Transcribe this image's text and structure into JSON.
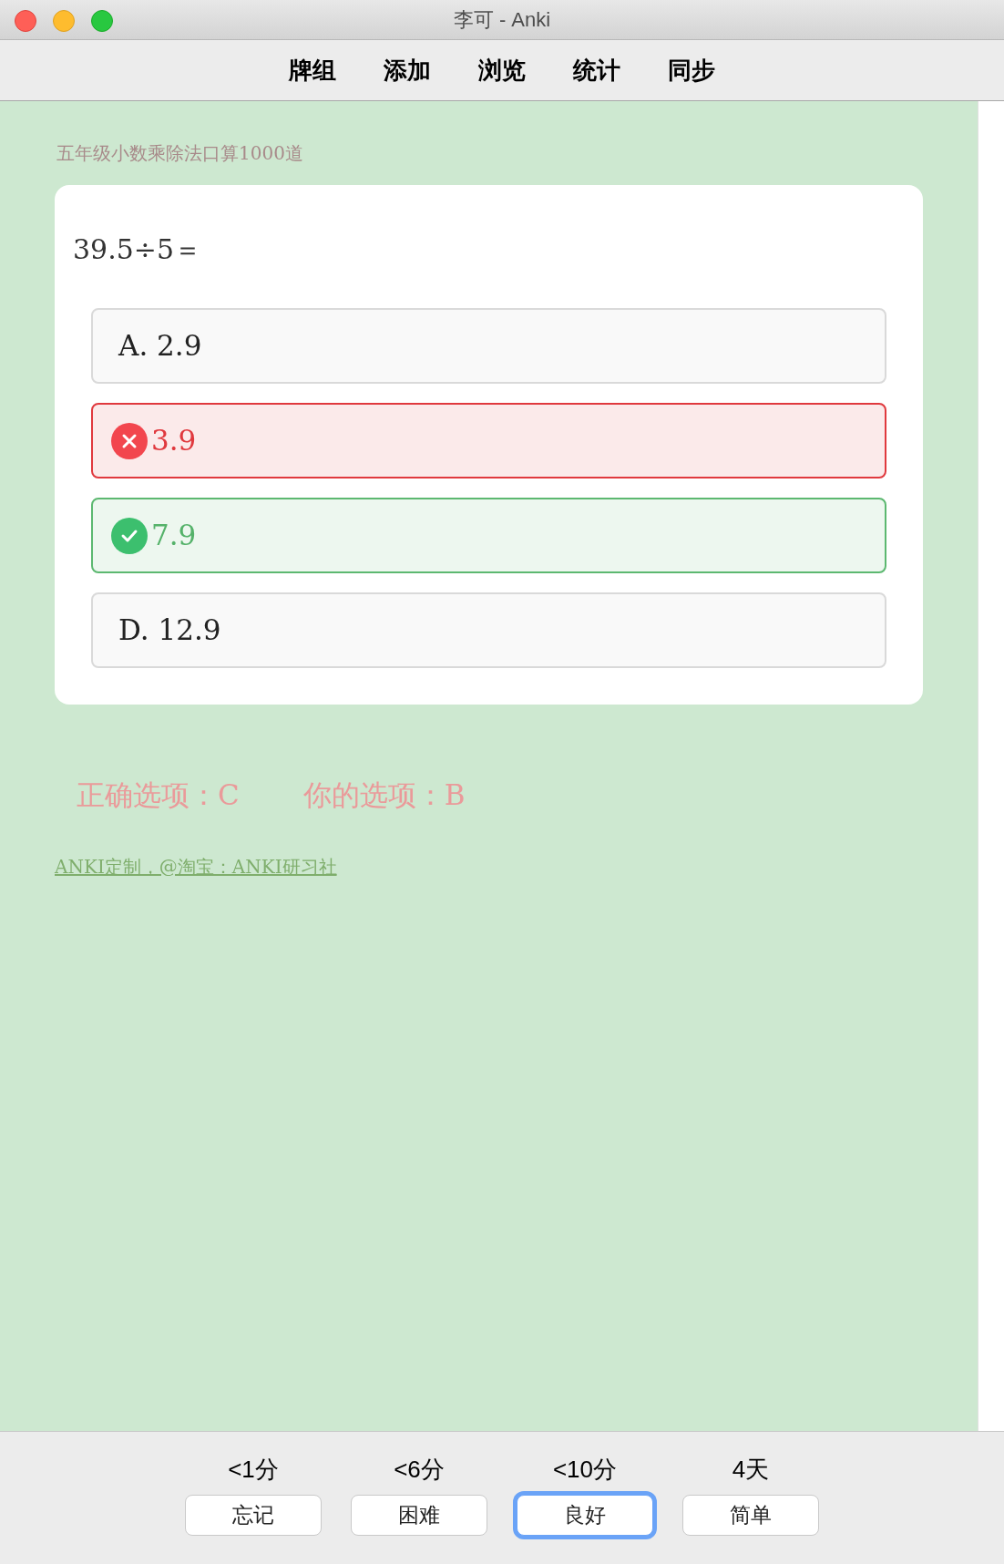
{
  "window": {
    "title": "李可 - Anki"
  },
  "toolbar": [
    "牌组",
    "添加",
    "浏览",
    "统计",
    "同步"
  ],
  "card": {
    "deck_title": "五年级小数乘除法口算1000道",
    "question": "39.5÷5＝",
    "options": [
      {
        "kind": "plain",
        "text": "A. 2.9"
      },
      {
        "kind": "wrong",
        "text": "3.9"
      },
      {
        "kind": "correct",
        "text": "7.9"
      },
      {
        "kind": "plain",
        "text": "D. 12.9"
      }
    ],
    "result": [
      "正确选项：C",
      "你的选项：B"
    ],
    "footer_link": "ANKI定制，@淘宝：ANKI研习社"
  },
  "answer_buttons": [
    {
      "interval": "<1分",
      "label": "忘记",
      "selected": false
    },
    {
      "interval": "<6分",
      "label": "困难",
      "selected": false
    },
    {
      "interval": "<10分",
      "label": "良好",
      "selected": true
    },
    {
      "interval": "4天",
      "label": "简单",
      "selected": false
    }
  ]
}
